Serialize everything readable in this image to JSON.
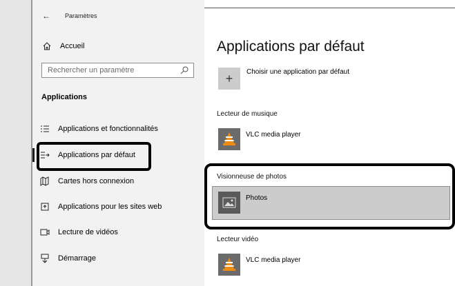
{
  "window": {
    "title": "Paramètres"
  },
  "sidebar": {
    "home_label": "Accueil",
    "search_placeholder": "Rechercher un paramètre",
    "section_heading": "Applications",
    "items": [
      {
        "label": "Applications et fonctionnalités",
        "icon": "list-icon"
      },
      {
        "label": "Applications par défaut",
        "icon": "default-apps-icon",
        "selected": true
      },
      {
        "label": "Cartes hors connexion",
        "icon": "map-icon"
      },
      {
        "label": "Applications pour les sites web",
        "icon": "web-apps-icon"
      },
      {
        "label": "Lecture de vidéos",
        "icon": "video-icon"
      },
      {
        "label": "Démarrage",
        "icon": "startup-icon"
      }
    ]
  },
  "main": {
    "title": "Applications par défaut",
    "choose_label": "Choisir une application par défaut",
    "categories": [
      {
        "label": "Lecteur de musique",
        "app": "VLC media player",
        "app_icon": "vlc-icon"
      },
      {
        "label": "Visionneuse de photos",
        "app": "Photos",
        "app_icon": "photos-icon"
      },
      {
        "label": "Lecteur vidéo",
        "app": "VLC media player",
        "app_icon": "vlc-icon"
      }
    ]
  },
  "colors": {
    "sidebar_bg": "#f2f2f2",
    "tile_bg": "#6b6b6b",
    "selected_bg": "#cccccc",
    "vlc_orange": "#f08b14"
  }
}
